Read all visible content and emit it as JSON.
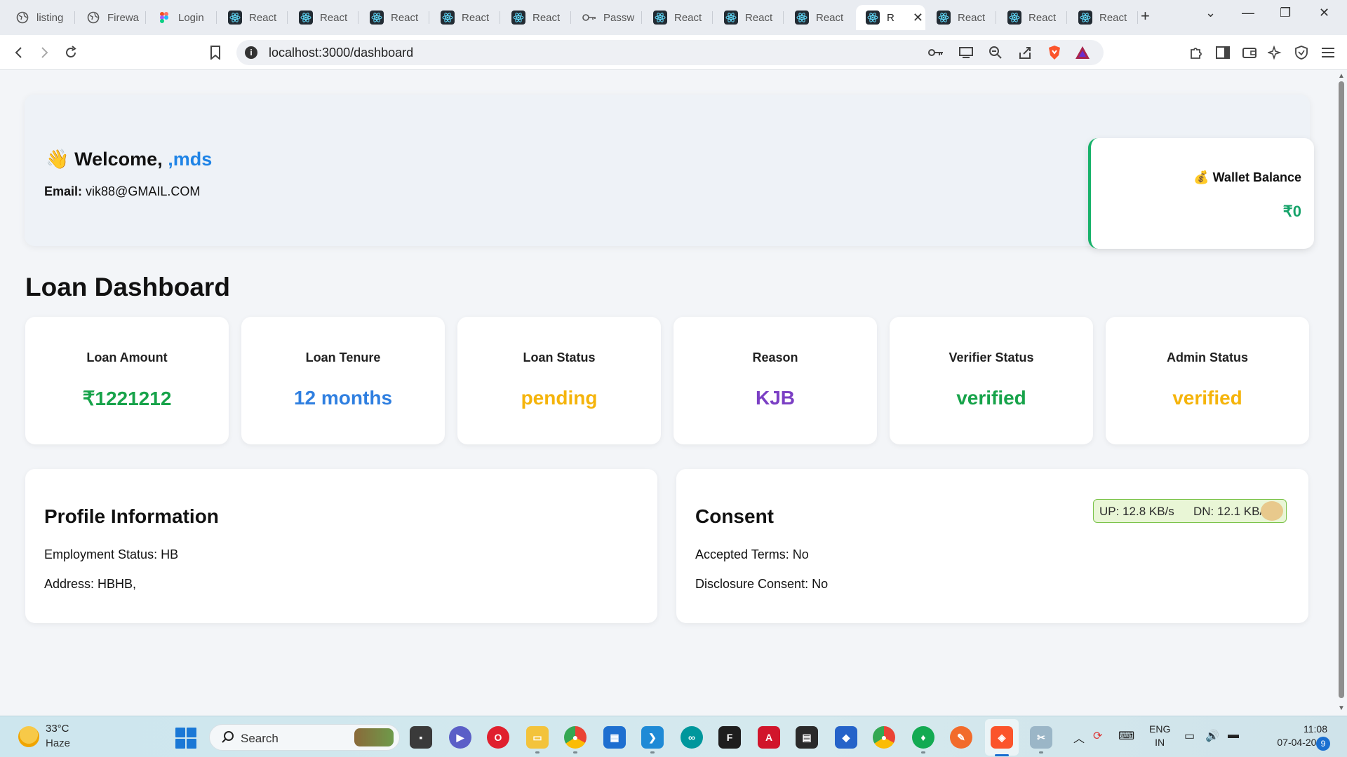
{
  "browser": {
    "tabs": [
      {
        "title": "listing",
        "icon": "globe-icon"
      },
      {
        "title": "Firewa",
        "icon": "globe-icon"
      },
      {
        "title": "Login",
        "icon": "figma-icon"
      },
      {
        "title": "React",
        "icon": "react-icon"
      },
      {
        "title": "React",
        "icon": "react-icon"
      },
      {
        "title": "React",
        "icon": "react-icon"
      },
      {
        "title": "React",
        "icon": "react-icon"
      },
      {
        "title": "React",
        "icon": "react-icon"
      },
      {
        "title": "Passw",
        "icon": "key-icon"
      },
      {
        "title": "React",
        "icon": "react-icon"
      },
      {
        "title": "React",
        "icon": "react-icon"
      },
      {
        "title": "React",
        "icon": "react-icon"
      },
      {
        "title": "R",
        "icon": "react-icon"
      },
      {
        "title": "React",
        "icon": "react-icon"
      },
      {
        "title": "React",
        "icon": "react-icon"
      },
      {
        "title": "React",
        "icon": "react-icon"
      }
    ],
    "active_tab_index": 12,
    "url": "localhost:3000/dashboard"
  },
  "welcome": {
    "emoji": "👋",
    "greeting": "Welcome,",
    "username": ",mds",
    "email_label": "Email:",
    "email_value": "vik88@GMAIL.COM"
  },
  "wallet": {
    "emoji": "💰",
    "label": "Wallet Balance",
    "value": "₹0"
  },
  "dashboard": {
    "title": "Loan Dashboard",
    "stats": [
      {
        "label": "Loan Amount",
        "value": "₹1221212",
        "color": "#17a34a"
      },
      {
        "label": "Loan Tenure",
        "value": "12 months",
        "color": "#2f7fe0"
      },
      {
        "label": "Loan Status",
        "value": "pending",
        "color": "#f5b40b"
      },
      {
        "label": "Reason",
        "value": "KJB",
        "color": "#7b3fc4"
      },
      {
        "label": "Verifier Status",
        "value": "verified",
        "color": "#17a34a"
      },
      {
        "label": "Admin Status",
        "value": "verified",
        "color": "#f5b40b"
      }
    ]
  },
  "profile": {
    "title": "Profile Information",
    "employment": "Employment Status: HB",
    "address": "Address: HBHB,"
  },
  "consent": {
    "title": "Consent",
    "accepted_terms": "Accepted Terms: No",
    "disclosure": "Disclosure Consent: No"
  },
  "netmonitor": {
    "up": "UP: 12.8 KB/s",
    "dn": "DN: 12.1 KB/s"
  },
  "taskbar": {
    "temperature": "33°C",
    "weather": "Haze",
    "search_placeholder": "Search",
    "lang_top": "ENG",
    "lang_bottom": "IN",
    "time": "11:08",
    "date": "07-04-2025",
    "notifications": "9"
  }
}
